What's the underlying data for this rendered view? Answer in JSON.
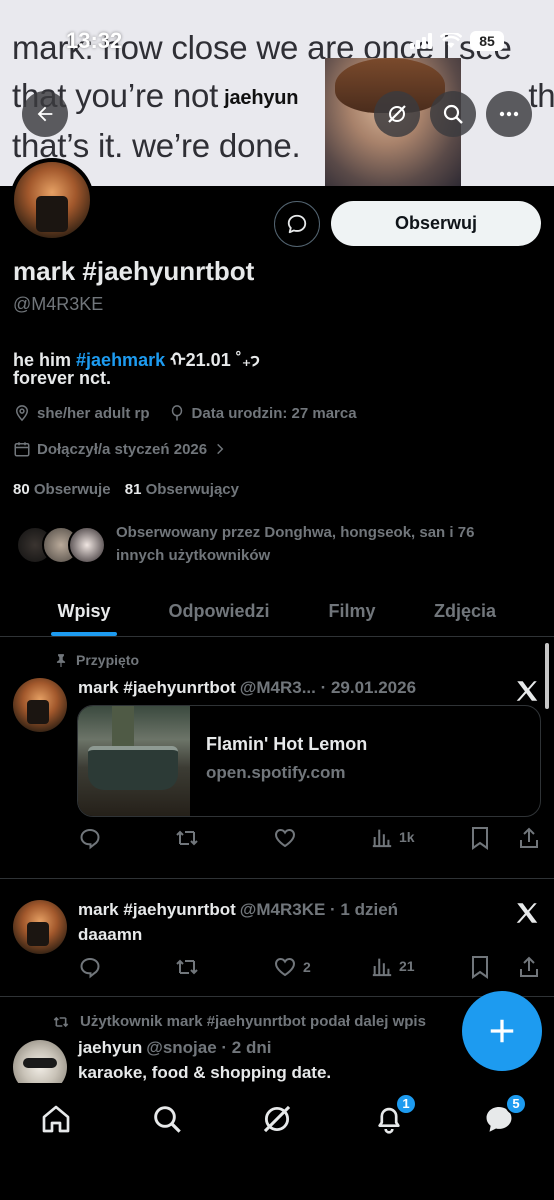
{
  "status_bar": {
    "time": "13:32",
    "battery": "85"
  },
  "banner": {
    "line1": "mark: how close we are once i see",
    "line2": "that you’re not",
    "tag": "jaehyun",
    "line2_end": "then",
    "line3": "that’s it. we’re done."
  },
  "header_icons": {
    "back": "arrow-left-icon",
    "grok": "grok-icon",
    "search": "search-icon",
    "more": "more-icon"
  },
  "profile": {
    "name": "mark #jaehyunrtbot",
    "handle": "@M4R3KE",
    "follow_button": "Obserwuj",
    "bio_prefix": "he him",
    "bio_hashtag": "#jaehmark",
    "bio_suffix": "ᡣ𐭩₊˚ 21.01",
    "bio_line2": "forever nct.",
    "location": "she/her adult rp",
    "birthday": "Data urodzin: 27 marca",
    "joined": "Dołączył/a styczeń 2026",
    "following_count": "80",
    "following_label": "Obserwuje",
    "followers_count": "81",
    "followers_label": "Obserwujący",
    "followed_by": "Obserwowany przez Donghwa, hongseok, san i 76 innych użytkowników"
  },
  "tabs": [
    "Wpisy",
    "Odpowiedzi",
    "Filmy",
    "Zdjęcia"
  ],
  "posts": [
    {
      "pinned_label": "Przypięto",
      "author": "mark #jaehyunrtbot",
      "handle_time": "@M4R3... · 29.01.2026",
      "card_title": "Flamin' Hot Lemon",
      "card_url": "open.spotify.com",
      "likes": "",
      "views": "1k"
    },
    {
      "author": "mark #jaehyunrtbot",
      "handle_time": "@M4R3KE · 1 dzień",
      "text": "daaamn",
      "likes": "2",
      "views": "21"
    },
    {
      "retweet_label": "Użytkownik mark #jaehyunrtbot podał dalej wpis",
      "author": "jaehyun",
      "handle_time": "@snojae · 2 dni",
      "text": "karaoke, food & shopping date."
    }
  ],
  "bottom_nav": {
    "items": [
      "home-icon",
      "search-icon",
      "grok-icon",
      "notifications-icon",
      "messages-icon"
    ],
    "notifications_badge": "1",
    "messages_badge": "5"
  },
  "colors": {
    "accent": "#1d9bf0",
    "background": "#000000",
    "text": "#e7e9ea",
    "muted": "#71767b",
    "border": "#2f3336"
  }
}
